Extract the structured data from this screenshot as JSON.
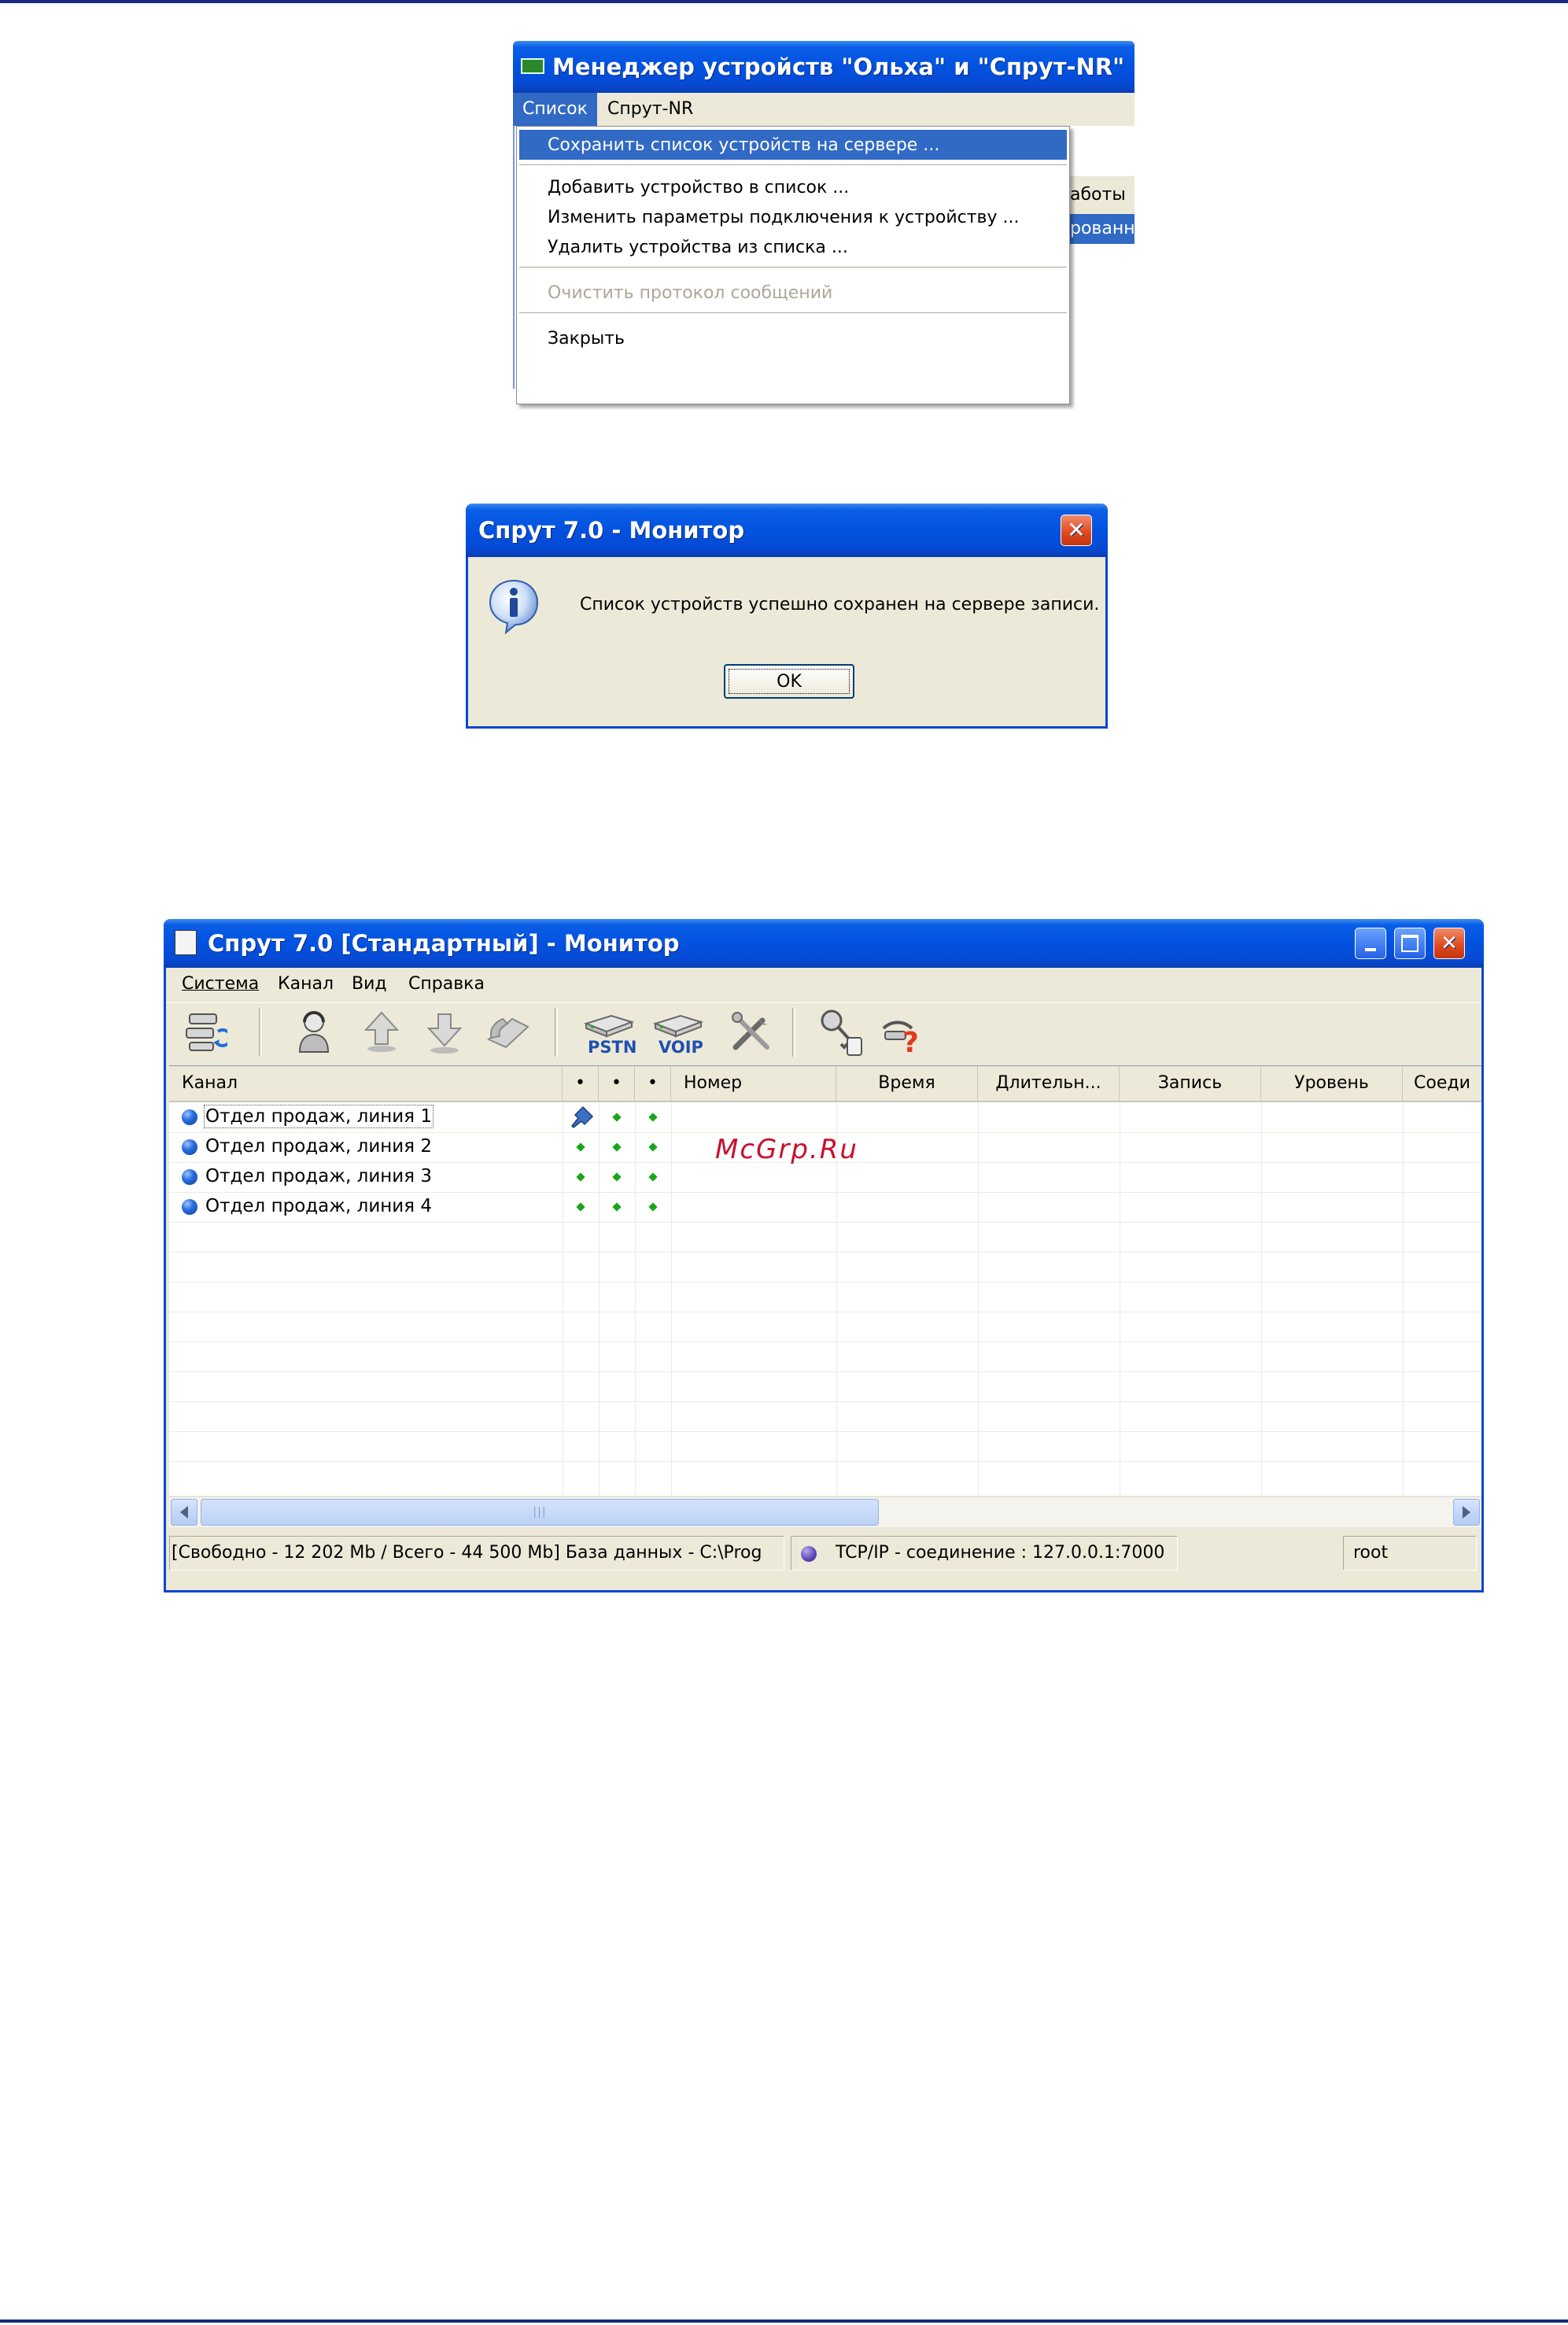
{
  "shot1": {
    "title": "Менеджер устройств \"Ольха\" и \"Спрут-NR\"",
    "menu": [
      "Список",
      "Спрут-NR"
    ],
    "bg_fragments": [
      "аботы",
      "рованны"
    ],
    "items": [
      {
        "label": "Сохранить список устройств на сервере ...",
        "state": "highlighted"
      },
      {
        "label": "Добавить устройство в список ...",
        "state": "normal"
      },
      {
        "label": "Изменить параметры  подключения к устройству ...",
        "state": "normal"
      },
      {
        "label": "Удалить устройства  из списка ...",
        "state": "normal"
      },
      {
        "label": "Очистить протокол сообщений",
        "state": "disabled"
      },
      {
        "label": "Закрыть",
        "state": "normal"
      }
    ]
  },
  "shot2": {
    "title": "Спрут 7.0 - Монитор",
    "message": "Список устройств успешно сохранен на сервере записи.",
    "ok_label": "OK"
  },
  "shot3": {
    "title": "Спрут 7.0 [Стандартный] - Монитор",
    "menu": [
      "Система",
      "Канал",
      "Вид",
      "Справка"
    ],
    "toolbar": [
      {
        "icon": "devices-icon"
      },
      {
        "icon": "operator-icon"
      },
      {
        "icon": "arrow-up-icon"
      },
      {
        "icon": "arrow-down-icon"
      },
      {
        "icon": "phone-icon"
      },
      {
        "icon": "pstn-device-icon",
        "label": "PSTN"
      },
      {
        "icon": "voip-device-icon",
        "label": "VOIP"
      },
      {
        "icon": "tools-icon"
      },
      {
        "icon": "key-icon"
      },
      {
        "icon": "help-icon"
      }
    ],
    "columns": [
      "Канал",
      "•",
      "•",
      "•",
      "Номер",
      "Время",
      "Длительн...",
      "Запись",
      "Уровень",
      "Соеди"
    ],
    "rows": [
      {
        "channel": "Отдел продаж, линия 1",
        "first_marker": "pin"
      },
      {
        "channel": "Отдел продаж, линия 2",
        "first_marker": "dot"
      },
      {
        "channel": "Отдел продаж, линия 3",
        "first_marker": "dot"
      },
      {
        "channel": "Отдел продаж, линия 4",
        "first_marker": "dot"
      }
    ],
    "watermark": "McGrp.Ru",
    "status": {
      "disk": "[Свободно - 12 202  Mb / Всего - 44 500  Mb] База данных - C:\\Prog",
      "connection": "TCP/IP - соединение : 127.0.0.1:7000",
      "user": "root"
    },
    "scrollbar_marks": "|||"
  },
  "colors": {
    "xp_title_blue": "#0252e0",
    "menu_highlight": "#316ac5",
    "window_face": "#ece9d8",
    "rule_navy": "#1a2a80",
    "dot_green": "#1aa51a",
    "watermark_red": "#c8102e",
    "close_red": "#e0471c"
  }
}
